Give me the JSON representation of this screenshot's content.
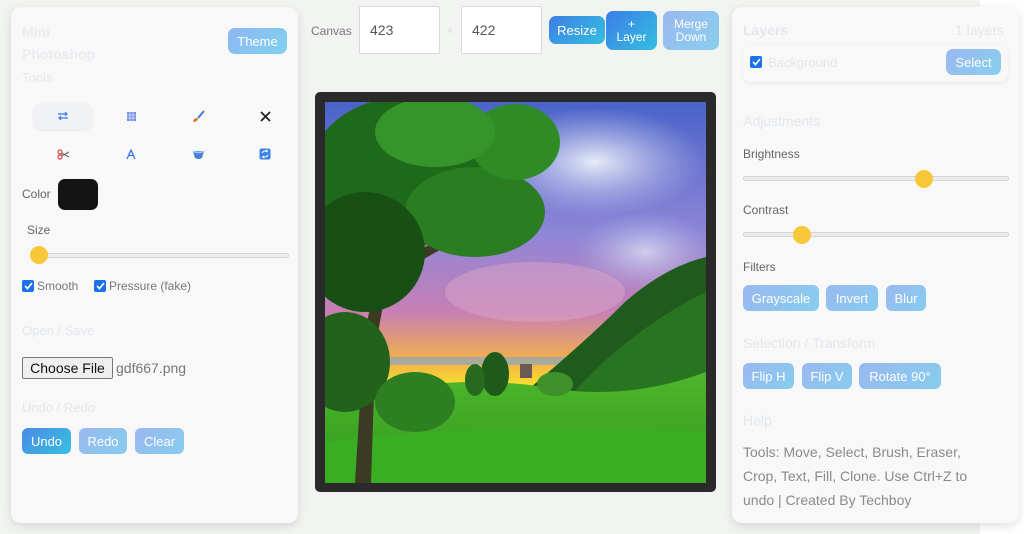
{
  "app": {
    "title": "Mini Photoshop"
  },
  "left": {
    "theme_label": "Theme",
    "tools_heading": "Tools",
    "tools": [
      {
        "icon": "move-icon",
        "active": true
      },
      {
        "icon": "select-grid-icon",
        "active": false
      },
      {
        "icon": "brush-icon",
        "active": false
      },
      {
        "icon": "eraser-x-icon",
        "active": false
      },
      {
        "icon": "scissors-icon",
        "active": false
      },
      {
        "icon": "text-a-icon",
        "active": false
      },
      {
        "icon": "fill-bucket-icon",
        "active": false
      },
      {
        "icon": "clone-icon",
        "active": false
      }
    ],
    "color_label": "Color",
    "color_value": "#141414",
    "size_label": "Size",
    "size_value": 0.03,
    "smooth_label": "Smooth",
    "pressure_label": "Pressure (fake)",
    "open_save_heading": "Open / Save",
    "choose_file_label": "Choose File",
    "file_name": "gdf667.png",
    "undo_redo_heading": "Undo / Redo",
    "undo_label": "Undo",
    "redo_label": "Redo",
    "clear_label": "Clear"
  },
  "topbar": {
    "canvas_label": "Canvas",
    "width_value": "423",
    "times": "x",
    "height_value": "422",
    "resize_label": "Resize",
    "add_layer_plus": "+",
    "add_layer_label": "Layer",
    "merge_line1": "Merge",
    "merge_line2": "Down"
  },
  "right": {
    "layers_heading": "Layers",
    "layers_count": "1 layers",
    "layer_name": "Background",
    "select_label": "Select",
    "adjustments_heading": "Adjustments",
    "brightness_label": "Brightness",
    "brightness_value": 0.68,
    "contrast_label": "Contrast",
    "contrast_value": 0.22,
    "filters_label": "Filters",
    "grayscale_label": "Grayscale",
    "invert_label": "Invert",
    "blur_label": "Blur",
    "transform_heading": "Selection / Transform",
    "flip_h_label": "Flip H",
    "flip_v_label": "Flip V",
    "rotate_label": "Rotate 90°",
    "help_heading": "Help",
    "help_text": "Tools: Move, Select, Brush, Eraser, Crop, Text, Fill, Clone. Use Ctrl+Z to undo | Created By Techboy"
  },
  "colors": {
    "accent": "#4b8ae6",
    "thumb": "#f7c83a",
    "canvas_frame": "#2a2a2a"
  }
}
